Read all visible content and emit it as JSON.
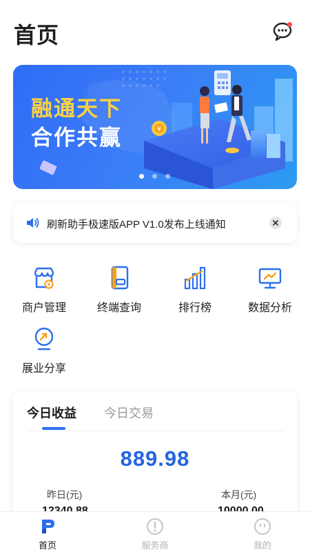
{
  "header": {
    "title": "首页"
  },
  "banner": {
    "line1": "融通天下",
    "line2": "合作共赢",
    "slides": 3,
    "active_slide": 1
  },
  "notice": {
    "text": "刷新助手极速版APP V1.0发布上线通知"
  },
  "menu": {
    "items": [
      {
        "label": "商户管理",
        "icon": "store-icon"
      },
      {
        "label": "终端查询",
        "icon": "pos-terminal-icon"
      },
      {
        "label": "排行榜",
        "icon": "ranking-chart-icon"
      },
      {
        "label": "数据分析",
        "icon": "analytics-board-icon"
      },
      {
        "label": "展业分享",
        "icon": "share-badge-icon"
      }
    ]
  },
  "income": {
    "tabs": [
      "今日收益",
      "今日交易"
    ],
    "active_tab": 0,
    "amount": "889.98",
    "yesterday_label": "昨日(元)",
    "yesterday_value": "12340.88",
    "month_label": "本月(元)",
    "month_value": "10000.00"
  },
  "bottom_nav": {
    "items": [
      {
        "label": "首页",
        "icon": "home-logo-icon",
        "active": true
      },
      {
        "label": "服务商",
        "icon": "service-provider-icon",
        "active": false
      },
      {
        "label": "我的",
        "icon": "profile-icon",
        "active": false
      }
    ]
  },
  "colors": {
    "accent": "#2b6fee",
    "amount": "#2364e0",
    "banner_highlight": "#ffd23f",
    "nav_inactive": "#c8c8c8"
  }
}
